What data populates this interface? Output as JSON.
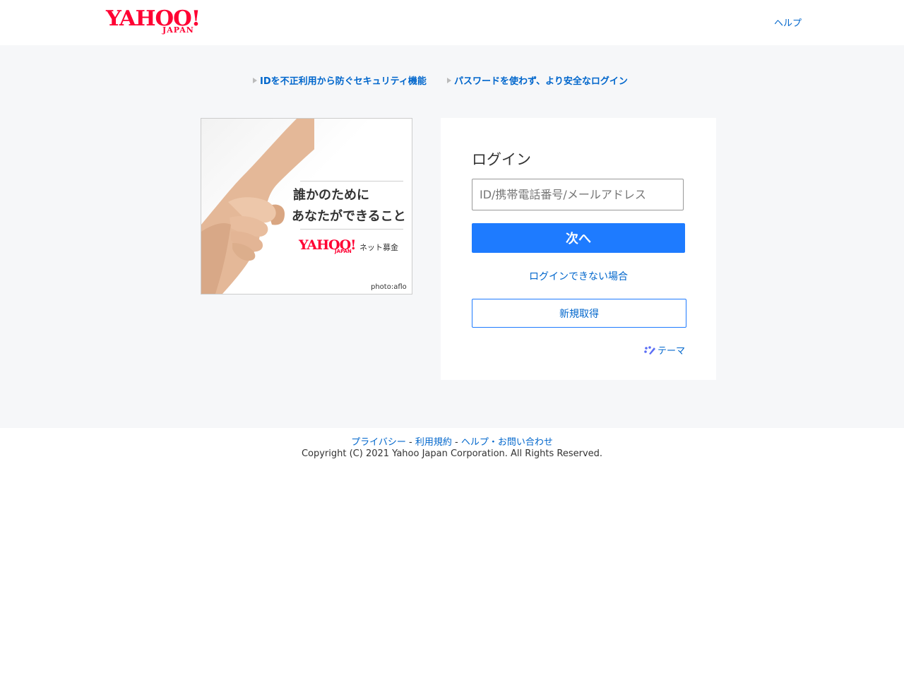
{
  "header": {
    "logo_text": "YAHOO!",
    "logo_sub": "JAPAN",
    "help_label": "ヘルプ"
  },
  "promos": [
    {
      "label": "IDを不正利用から防ぐセキュリティ機能"
    },
    {
      "label": "パスワードを使わず、より安全なログイン"
    }
  ],
  "ad": {
    "line1": "誰かのために",
    "line2": "あなたができること",
    "logo_text": "YAHOO!",
    "logo_sub": "JAPAN",
    "service": "ネット募金",
    "credit": "photo:aflo"
  },
  "login": {
    "title": "ログイン",
    "id_placeholder": "ID/携帯電話番号/メールアドレス",
    "id_value": "",
    "next_label": "次へ",
    "cant_login_label": "ログインできない場合",
    "register_label": "新規取得",
    "theme_label": "テーマ"
  },
  "footer": {
    "privacy": "プライバシー",
    "terms": "利用規約",
    "help": "ヘルプ・お問い合わせ",
    "separator": "-",
    "copyright": "Copyright (C) 2021 Yahoo Japan Corporation. All Rights Reserved."
  },
  "colors": {
    "brand": "#ff0033",
    "link": "#0066cc",
    "primary_button": "#1e7bff",
    "background": "#f6f7f9"
  }
}
